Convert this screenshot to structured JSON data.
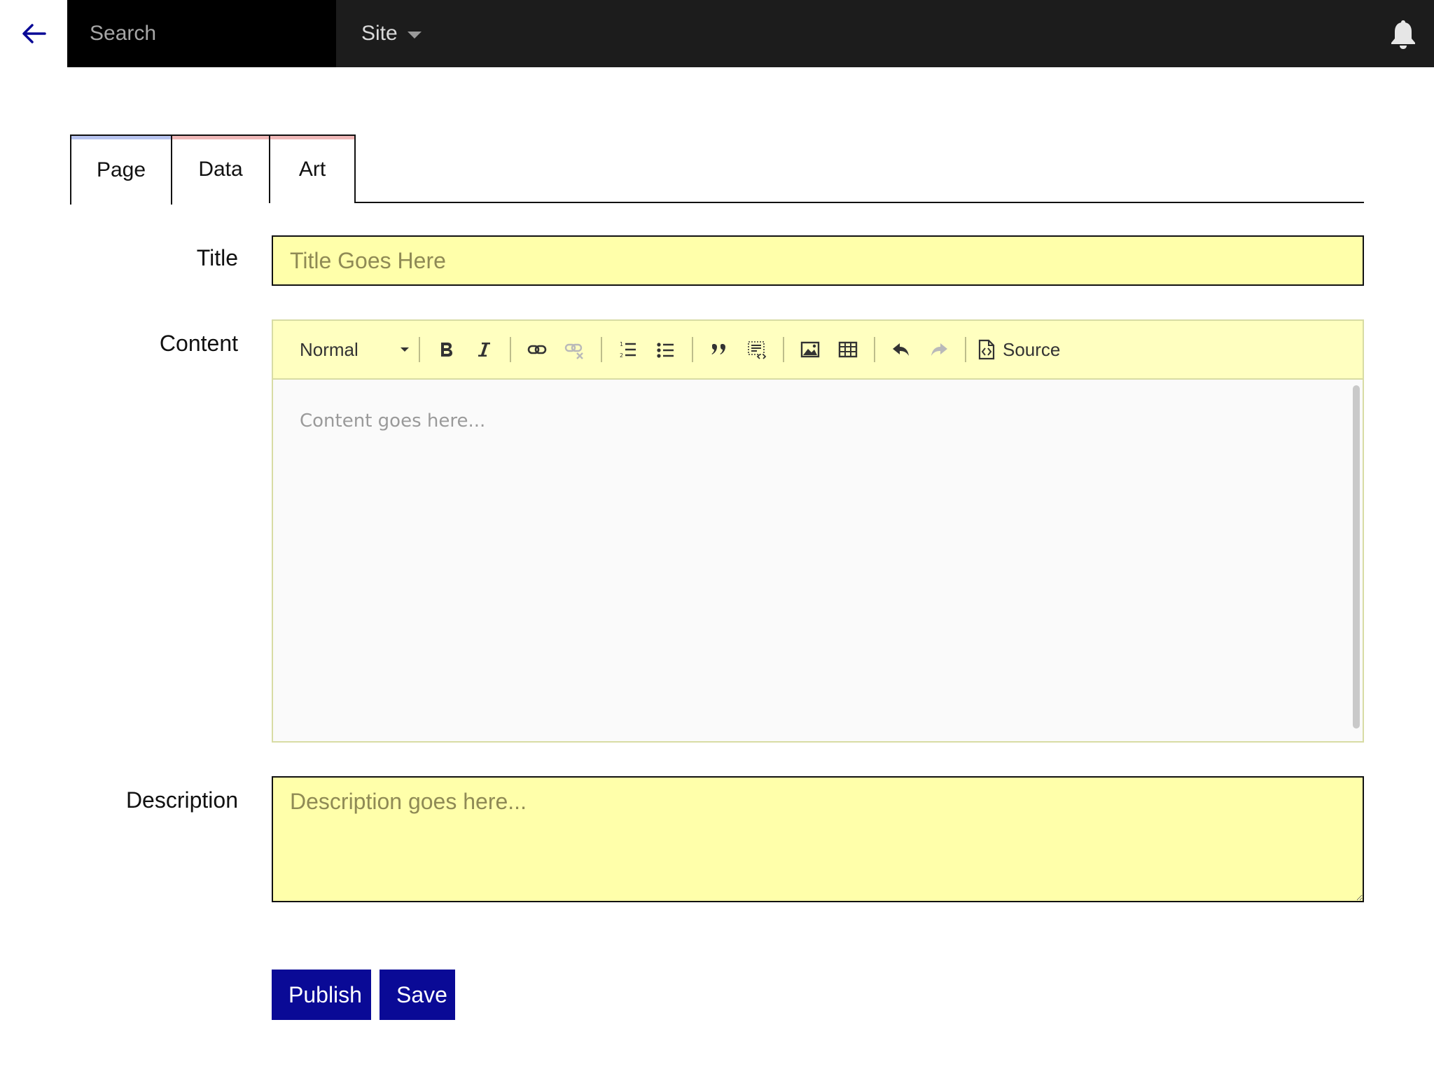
{
  "topbar": {
    "search_placeholder": "Search",
    "site_label": "Site"
  },
  "tabs": [
    {
      "label": "Page",
      "active": true,
      "accent": "#b8c4f0"
    },
    {
      "label": "Data",
      "active": false,
      "accent": "#f0b8b8"
    },
    {
      "label": "Art",
      "active": false,
      "accent": "#f0b8b8"
    }
  ],
  "form": {
    "title_label": "Title",
    "title_placeholder": "Title Goes Here",
    "content_label": "Content",
    "content_placeholder": "Content goes here...",
    "description_label": "Description",
    "description_placeholder": "Description goes here..."
  },
  "toolbar": {
    "format_value": "Normal",
    "source_label": "Source",
    "icons": [
      "bold-icon",
      "italic-icon",
      "link-icon",
      "unlink-icon",
      "numbered-list-icon",
      "bulleted-list-icon",
      "blockquote-icon",
      "div-container-icon",
      "image-icon",
      "table-icon",
      "undo-icon",
      "redo-icon",
      "source-icon"
    ]
  },
  "actions": {
    "publish_label": "Publish",
    "save_label": "Save"
  },
  "colors": {
    "topbar_bg": "#1c1c1c",
    "field_bg": "#ffffaa",
    "button_bg": "#0a0a96",
    "back_arrow": "#0a0a96"
  }
}
